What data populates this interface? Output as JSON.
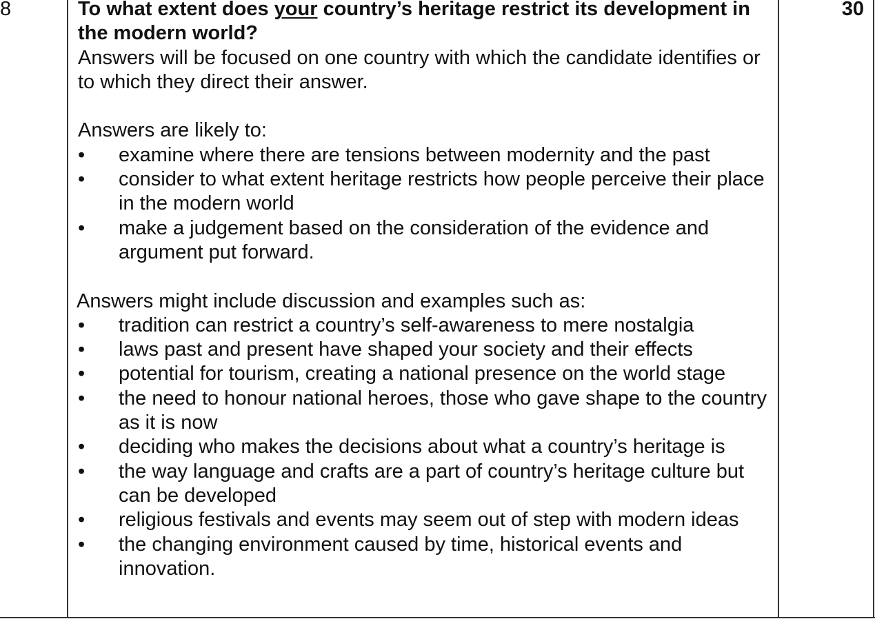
{
  "question_number": "8",
  "marks": "30",
  "question": {
    "before": "To what extent does ",
    "underlined": "your",
    "after": " country’s heritage restrict its development in the modern world?"
  },
  "intro": "Answers will be focused on one country with which the candidate identifies or to which they direct their answer.",
  "likely": {
    "heading": "Answers are likely to:",
    "items": [
      "examine where there are tensions between modernity and the past",
      "consider to what extent heritage restricts how people perceive their place in the modern world",
      "make a judgement based on the consideration of the evidence and argument put forward."
    ]
  },
  "examples": {
    "heading": "Answers might include discussion and examples such as:",
    "items": [
      "tradition can restrict a country’s self-awareness to mere nostalgia",
      "laws past and present have shaped your society and their effects",
      "potential for tourism, creating a national presence on the world stage",
      "the need to honour national heroes, those who gave shape to the country as it is now",
      "deciding who makes the decisions about what a country’s heritage is",
      "the way language and crafts are a part of country’s heritage culture but can be developed",
      "religious festivals and events may seem out of step with modern ideas",
      "the changing environment caused by time, historical events and innovation."
    ]
  },
  "bullet_char": "•"
}
